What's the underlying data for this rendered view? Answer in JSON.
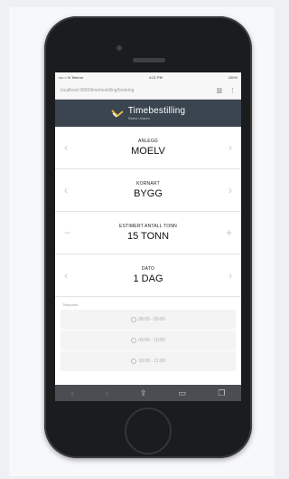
{
  "status": {
    "carrier": "•••○○ N Telenor",
    "time": "4:21 PM",
    "battery": "100%"
  },
  "browser": {
    "url": "localhost:3000/timebestilling/booking"
  },
  "app": {
    "title": "Timebestilling",
    "subtitle": "Strand Unikorn"
  },
  "fields": [
    {
      "label": "ANLEGG",
      "value": "MOELV",
      "left": "‹",
      "right": "›"
    },
    {
      "label": "KORNART",
      "value": "BYGG",
      "left": "‹",
      "right": "›"
    },
    {
      "label": "ESTIMERT ANTALL TONN",
      "value": "15 TONN",
      "left": "−",
      "right": "+"
    },
    {
      "label": "DATO",
      "value": "1 DAG",
      "left": "‹",
      "right": "›"
    }
  ],
  "tidspunkt_label": "Tidspunkt",
  "slots": [
    "08:00 - 09:00",
    "09:00 - 10:00",
    "10:00 - 11:00"
  ],
  "colors": {
    "header_bg": "#3a4550",
    "toolbar_bg": "#4a4d52",
    "phone_body": "#1b1c1e"
  }
}
